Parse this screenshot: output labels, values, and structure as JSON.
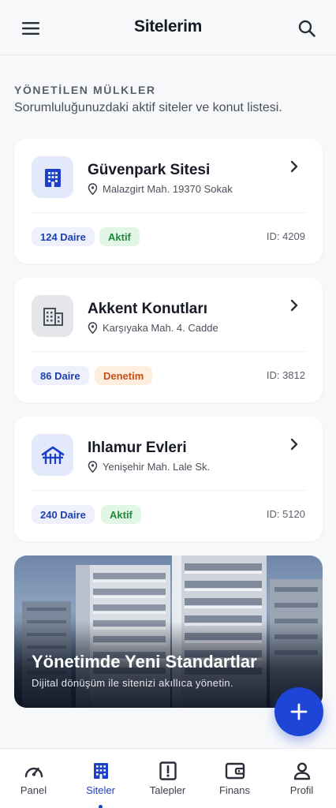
{
  "header": {
    "title": "Sitelerim",
    "menu_icon": "hamburger-menu-icon",
    "search_icon": "search-icon"
  },
  "section": {
    "eyebrow": "YÖNETİLEN MÜLKLER",
    "subtitle": "Sorumluluğunuzdaki aktif siteler ve konut listesi."
  },
  "sites": [
    {
      "name": "Güvenpark Sitesi",
      "address": "Malazgirt Mah. 19370 Sokak",
      "units": "124 Daire",
      "status": "Aktif",
      "id": "ID: 4209",
      "icon": "apartment-icon",
      "colors": {
        "icon_bg": "#e3e8fb",
        "icon_fg": "#1d40c8",
        "status_bg": "#e2f6e6",
        "status_fg": "#1e8a3a"
      }
    },
    {
      "name": "Akkent Konutları",
      "address": "Karşıyaka Mah. 4. Cadde",
      "units": "86 Daire",
      "status": "Denetim",
      "id": "ID: 3812",
      "icon": "office-building-icon",
      "colors": {
        "icon_bg": "#e4e6ea",
        "icon_fg": "#4a4f5b",
        "status_bg": "#fdeedd",
        "status_fg": "#c2501a"
      }
    },
    {
      "name": "Ihlamur Evleri",
      "address": "Yenişehir Mah. Lale Sk.",
      "units": "240 Daire",
      "status": "Aktif",
      "id": "ID: 5120",
      "icon": "house-icon",
      "colors": {
        "icon_bg": "#e3e8fb",
        "icon_fg": "#1d40c8",
        "status_bg": "#e2f6e6",
        "status_fg": "#1e8a3a"
      }
    }
  ],
  "banner": {
    "title": "Yönetimde Yeni Standartlar",
    "subtitle": "Dijital dönüşüm ile sitenizi akıllıca yönetin."
  },
  "fab": {
    "icon": "plus-icon"
  },
  "nav": [
    {
      "label": "Panel",
      "icon": "speedometer-icon",
      "active": false
    },
    {
      "label": "Siteler",
      "icon": "apartment-icon",
      "active": true
    },
    {
      "label": "Talepler",
      "icon": "alert-clipboard-icon",
      "active": false
    },
    {
      "label": "Finans",
      "icon": "wallet-icon",
      "active": false
    },
    {
      "label": "Profil",
      "icon": "person-icon",
      "active": false
    }
  ],
  "colors": {
    "accent": "#1d40c8",
    "fab": "#1d45d6",
    "background": "#f7f8fa"
  }
}
